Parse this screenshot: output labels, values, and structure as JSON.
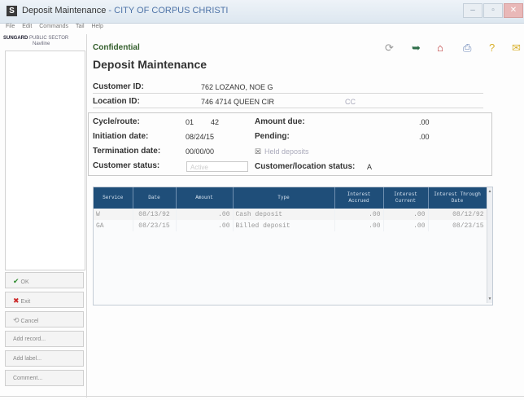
{
  "window": {
    "app_icon": "S",
    "title_main": "Deposit Maintenance",
    "title_sep": " - ",
    "title_org": "CITY OF CORPUS CHRISTI",
    "controls": {
      "minimize": "–",
      "maximize": "▫",
      "close": "✕"
    }
  },
  "menu": [
    "File",
    "Edit",
    "Commands",
    "Tail",
    "Help"
  ],
  "brand": {
    "line1": "SUNGARD",
    "line1b": "PUBLIC SECTOR",
    "line2": "Naviline"
  },
  "sidebar": {
    "ok": "OK",
    "exit": "Exit",
    "cancel": "Cancel",
    "add1": "Add record...",
    "add2": "Add label...",
    "comment": "Comment..."
  },
  "header": {
    "confidential": "Confidential",
    "title": "Deposit Maintenance"
  },
  "toolbar_icons": [
    "refresh-icon",
    "forward-icon",
    "house-icon",
    "printer-icon",
    "help-icon",
    "mail-icon"
  ],
  "customer": {
    "id_label": "Customer ID:",
    "id_value": "762 LOZANO, NOE G",
    "location_label": "Location ID:",
    "location_value": "746 4714 QUEEN CIR",
    "location_extra": "CC"
  },
  "details": {
    "cycle_label": "Cycle/route:",
    "cycle_value": "01",
    "route_value": "42",
    "initiation_label": "Initiation date:",
    "initiation_value": "08/24/15",
    "termination_label": "Termination date:",
    "termination_value": "00/00/00",
    "status_label": "Customer status:",
    "status_value": "Active",
    "amount_due_label": "Amount due:",
    "amount_due_value": ".00",
    "pending_label": "Pending:",
    "pending_value": ".00",
    "held_label": "Held deposits",
    "custloc_label": "Customer/location status:",
    "custloc_value": "A"
  },
  "grid": {
    "headers": [
      "Service",
      "Date",
      "Amount",
      "Type",
      "Interest Accrued",
      "Interest Current",
      "Interest Through Date"
    ],
    "rows": [
      [
        "W",
        "08/13/92",
        ".00",
        "Cash deposit",
        ".00",
        ".00",
        "08/12/92"
      ],
      [
        "GA",
        "08/23/15",
        ".00",
        "Billed deposit",
        ".00",
        ".00",
        "08/23/15"
      ]
    ]
  }
}
